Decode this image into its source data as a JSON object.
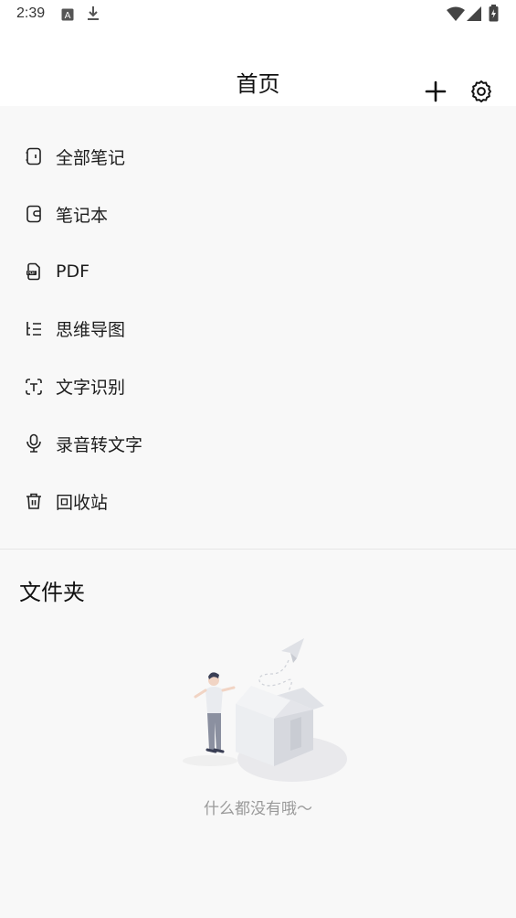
{
  "status_bar": {
    "time": "2:39",
    "icons": [
      "font-notification-icon",
      "download-icon",
      "wifi-icon",
      "cell-signal-icon",
      "battery-charging-icon"
    ]
  },
  "header": {
    "title": "首页",
    "actions": [
      "add-icon",
      "settings-icon"
    ]
  },
  "menu": {
    "items": [
      {
        "label": "全部笔记",
        "icon": "all-notes-icon"
      },
      {
        "label": "笔记本",
        "icon": "notebook-icon"
      },
      {
        "label": "PDF",
        "icon": "pdf-icon"
      },
      {
        "label": "思维导图",
        "icon": "mind-map-icon"
      },
      {
        "label": "文字识别",
        "icon": "text-recognition-icon"
      },
      {
        "label": "录音转文字",
        "icon": "microphone-icon"
      },
      {
        "label": "回收站",
        "icon": "trash-icon"
      }
    ]
  },
  "folders": {
    "title": "文件夹",
    "empty_text": "什么都没有哦～"
  }
}
